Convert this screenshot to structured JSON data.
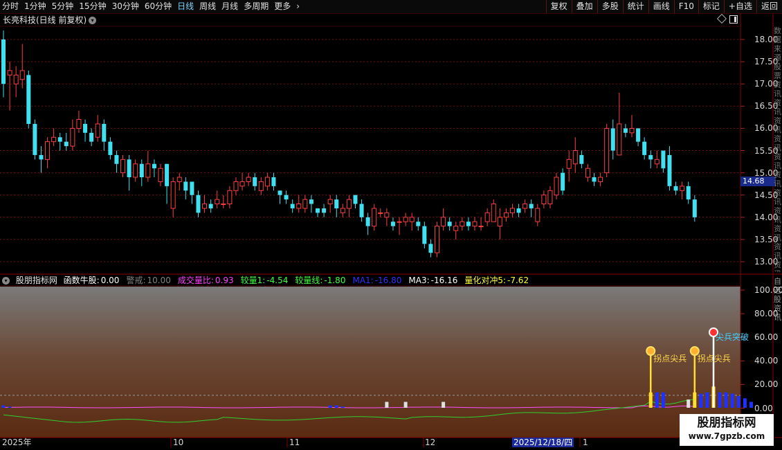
{
  "toolbar": {
    "periods": [
      "分时",
      "1分钟",
      "5分钟",
      "15分钟",
      "30分钟",
      "60分钟",
      "日线",
      "周线",
      "月线",
      "多周期",
      "更多"
    ],
    "active_period": "日线",
    "buttons": [
      "复权",
      "叠加",
      "多股",
      "统计",
      "画线",
      "F10",
      "标记",
      "+自选",
      "返回"
    ]
  },
  "chart_header": {
    "title": "长亮科技(日线 前复权)"
  },
  "price_axis": {
    "ticks": [
      "18.00",
      "17.50",
      "17.00",
      "16.50",
      "16.00",
      "15.50",
      "15.00",
      "14.50",
      "14.00",
      "13.50",
      "13.00"
    ]
  },
  "current_price": "14.68",
  "indicator": {
    "name": "股朋指标网",
    "items": [
      {
        "label": "函数牛股:",
        "value": "0.00",
        "color": "#ffffff"
      },
      {
        "label": "警戒:",
        "value": "10.00",
        "color": "#808080"
      },
      {
        "label": "成交量比:",
        "value": "0.93",
        "color": "#ff40ff"
      },
      {
        "label": "较量1:",
        "value": "-4.54",
        "color": "#40ff40"
      },
      {
        "label": "较量线:",
        "value": "-1.80",
        "color": "#40ff40"
      },
      {
        "label": "MA1:",
        "value": "-16.80",
        "color": "#3030ff"
      },
      {
        "label": "MA3:",
        "value": "-16.16",
        "color": "#ffffff"
      },
      {
        "label": "量化对冲5:",
        "value": "-7.62",
        "color": "#ffff40"
      }
    ],
    "axis_ticks": [
      "100.00",
      "80.00",
      "60.00",
      "40.00",
      "20.00",
      "0.00"
    ],
    "signals": [
      {
        "text": "拐点尖兵",
        "type": "buy-point"
      },
      {
        "text": "拐点尖兵",
        "type": "buy-point"
      },
      {
        "text": "尖兵突破",
        "type": "breakout"
      }
    ]
  },
  "edge_text": "数据来源股票资讯资讯资讯资讯资讯资讯资讯资讯资讯资讯资讯开盘资讯资讯",
  "edge_text_2": "自选股资讯",
  "date_axis": {
    "labels": [
      "2025年",
      "10",
      "11",
      "12",
      "1"
    ],
    "cursor_date": "2025/12/18/四"
  },
  "watermark": {
    "line1": "股朋指标网",
    "line2": "www.7gpzb.com"
  },
  "chart_data": {
    "type": "candlestick",
    "ylim": [
      12.8,
      18.4
    ],
    "candles": [
      [
        18.0,
        17.0,
        18.2,
        16.7
      ],
      [
        17.2,
        17.3,
        17.5,
        16.4
      ],
      [
        17.0,
        17.2,
        17.4,
        16.7
      ],
      [
        17.1,
        17.3,
        17.9,
        16.9
      ],
      [
        17.2,
        16.1,
        17.3,
        16.0
      ],
      [
        16.1,
        15.4,
        16.2,
        15.3
      ],
      [
        15.4,
        15.3,
        15.6,
        15.0
      ],
      [
        15.3,
        15.7,
        15.8,
        15.1
      ],
      [
        15.7,
        15.8,
        16.0,
        15.6
      ],
      [
        15.8,
        15.7,
        15.9,
        15.5
      ],
      [
        15.7,
        15.6,
        15.9,
        15.5
      ],
      [
        15.6,
        16.0,
        16.2,
        15.5
      ],
      [
        16.0,
        16.2,
        16.4,
        15.9
      ],
      [
        16.1,
        15.9,
        16.2,
        15.7
      ],
      [
        15.9,
        15.7,
        16.0,
        15.6
      ],
      [
        15.8,
        16.1,
        16.3,
        15.7
      ],
      [
        16.1,
        15.7,
        16.2,
        15.5
      ],
      [
        15.7,
        15.4,
        15.8,
        15.3
      ],
      [
        15.4,
        15.2,
        15.5,
        15.0
      ],
      [
        15.0,
        15.3,
        15.4,
        14.9
      ],
      [
        15.3,
        14.9,
        15.4,
        14.6
      ],
      [
        14.9,
        15.2,
        15.3,
        14.8
      ],
      [
        15.2,
        14.9,
        15.3,
        14.7
      ],
      [
        14.9,
        15.2,
        15.5,
        14.8
      ],
      [
        15.2,
        15.1,
        15.3,
        14.9
      ],
      [
        14.8,
        15.1,
        15.2,
        14.7
      ],
      [
        15.2,
        14.7,
        15.2,
        14.3
      ],
      [
        14.2,
        14.8,
        14.9,
        14.0
      ],
      [
        14.8,
        14.9,
        15.0,
        14.6
      ],
      [
        14.8,
        14.6,
        14.9,
        14.4
      ],
      [
        14.8,
        14.5,
        14.8,
        14.3
      ],
      [
        14.5,
        14.1,
        14.6,
        14.0
      ],
      [
        14.2,
        14.3,
        14.5,
        14.1
      ],
      [
        14.3,
        14.2,
        14.4,
        14.1
      ],
      [
        14.3,
        14.4,
        14.6,
        14.2
      ],
      [
        14.3,
        14.3,
        14.5,
        14.2
      ],
      [
        14.3,
        14.6,
        14.7,
        14.2
      ],
      [
        14.6,
        14.8,
        14.9,
        14.5
      ],
      [
        14.7,
        14.8,
        15.0,
        14.6
      ],
      [
        14.8,
        14.9,
        15.0,
        14.7
      ],
      [
        14.9,
        14.7,
        15.0,
        14.6
      ],
      [
        14.6,
        14.8,
        14.9,
        14.5
      ],
      [
        14.7,
        14.9,
        15.0,
        14.6
      ],
      [
        14.9,
        14.7,
        15.0,
        14.6
      ],
      [
        14.6,
        14.5,
        14.6,
        14.3
      ],
      [
        14.5,
        14.4,
        14.6,
        14.3
      ],
      [
        14.3,
        14.2,
        14.4,
        14.1
      ],
      [
        14.2,
        14.3,
        14.5,
        14.1
      ],
      [
        14.2,
        14.4,
        14.5,
        14.1
      ],
      [
        14.4,
        14.3,
        14.5,
        14.1
      ],
      [
        14.2,
        14.1,
        14.2,
        14.0
      ],
      [
        14.2,
        14.1,
        14.3,
        14.0
      ],
      [
        14.3,
        14.4,
        14.5,
        14.1
      ],
      [
        14.4,
        14.2,
        14.5,
        14.0
      ],
      [
        14.1,
        14.2,
        14.3,
        14.0
      ],
      [
        14.2,
        14.4,
        14.5,
        14.0
      ],
      [
        14.5,
        14.3,
        14.5,
        14.2
      ],
      [
        14.3,
        14.0,
        14.4,
        13.9
      ],
      [
        14.0,
        13.8,
        14.1,
        13.6
      ],
      [
        13.8,
        14.2,
        14.3,
        13.7
      ],
      [
        14.1,
        14.1,
        14.2,
        14.0
      ],
      [
        14.0,
        14.1,
        14.2,
        13.8
      ],
      [
        13.9,
        13.8,
        14.0,
        13.7
      ],
      [
        13.9,
        13.9,
        14.0,
        13.6
      ],
      [
        13.9,
        14.0,
        14.1,
        13.8
      ],
      [
        13.9,
        14.0,
        14.1,
        13.7
      ],
      [
        13.9,
        13.8,
        14.0,
        13.7
      ],
      [
        13.8,
        13.4,
        13.9,
        13.3
      ],
      [
        13.4,
        13.2,
        13.5,
        13.1
      ],
      [
        13.2,
        13.8,
        13.9,
        13.1
      ],
      [
        13.8,
        14.0,
        14.2,
        13.7
      ],
      [
        13.9,
        13.8,
        14.0,
        13.7
      ],
      [
        13.7,
        13.8,
        13.9,
        13.5
      ],
      [
        13.8,
        13.9,
        14.0,
        13.7
      ],
      [
        13.9,
        13.8,
        14.0,
        13.7
      ],
      [
        13.8,
        13.9,
        14.0,
        13.7
      ],
      [
        13.8,
        13.8,
        14.0,
        13.7
      ],
      [
        13.9,
        14.1,
        14.2,
        13.8
      ],
      [
        13.9,
        14.3,
        14.4,
        13.9
      ],
      [
        13.8,
        14.0,
        14.2,
        13.5
      ],
      [
        14.0,
        14.1,
        14.2,
        13.9
      ],
      [
        14.1,
        14.2,
        14.3,
        14.0
      ],
      [
        14.2,
        14.1,
        14.3,
        14.0
      ],
      [
        14.2,
        14.3,
        14.4,
        14.1
      ],
      [
        14.3,
        14.2,
        14.4,
        14.0
      ],
      [
        13.9,
        14.2,
        14.3,
        13.8
      ],
      [
        14.3,
        14.5,
        14.6,
        14.2
      ],
      [
        14.3,
        14.6,
        14.7,
        14.2
      ],
      [
        14.5,
        14.9,
        15.0,
        14.4
      ],
      [
        15.0,
        14.6,
        15.1,
        14.5
      ],
      [
        15.1,
        15.3,
        15.5,
        14.8
      ],
      [
        15.2,
        15.5,
        15.8,
        15.0
      ],
      [
        15.4,
        15.2,
        15.5,
        15.1
      ],
      [
        14.9,
        15.1,
        15.2,
        14.8
      ],
      [
        14.9,
        14.8,
        15.0,
        14.7
      ],
      [
        14.8,
        14.9,
        15.0,
        14.7
      ],
      [
        15.0,
        16.0,
        16.1,
        14.9
      ],
      [
        16.0,
        15.5,
        16.2,
        15.3
      ],
      [
        15.4,
        16.1,
        16.8,
        15.4
      ],
      [
        16.0,
        15.9,
        16.1,
        15.8
      ],
      [
        15.9,
        16.0,
        16.3,
        15.8
      ],
      [
        16.0,
        15.7,
        16.0,
        15.6
      ],
      [
        15.7,
        15.4,
        15.8,
        15.3
      ],
      [
        15.4,
        15.3,
        15.5,
        15.1
      ],
      [
        15.2,
        15.3,
        15.5,
        15.1
      ],
      [
        15.5,
        15.1,
        15.5,
        15.0
      ],
      [
        15.4,
        14.7,
        15.6,
        14.6
      ],
      [
        14.7,
        14.6,
        14.8,
        14.5
      ],
      [
        14.6,
        14.7,
        14.8,
        14.4
      ],
      [
        14.7,
        14.4,
        14.8,
        14.3
      ],
      [
        14.4,
        14.0,
        14.5,
        13.9
      ]
    ],
    "volume_bars": [
      {
        "i": 0,
        "v": 2,
        "color": "blue"
      },
      {
        "i": 1,
        "v": 1,
        "color": "blue"
      },
      {
        "i": 52,
        "v": 2,
        "color": "blue"
      },
      {
        "i": 53,
        "v": 2,
        "color": "blue"
      },
      {
        "i": 54,
        "v": 1,
        "color": "blue"
      },
      {
        "i": 61,
        "v": 5,
        "color": "white"
      },
      {
        "i": 64,
        "v": 5,
        "color": "white"
      },
      {
        "i": 70,
        "v": 5,
        "color": "white"
      },
      {
        "i": 103,
        "v": 13,
        "color": "yellow"
      },
      {
        "i": 104,
        "v": 13,
        "color": "blue"
      },
      {
        "i": 105,
        "v": 13,
        "color": "blue"
      },
      {
        "i": 109,
        "v": 7,
        "color": "white"
      },
      {
        "i": 110,
        "v": 13,
        "color": "yellow"
      },
      {
        "i": 111,
        "v": 12,
        "color": "blue"
      },
      {
        "i": 112,
        "v": 13,
        "color": "blue"
      },
      {
        "i": 113,
        "v": 18,
        "color": "yellow"
      },
      {
        "i": 114,
        "v": 13,
        "color": "blue"
      },
      {
        "i": 115,
        "v": 13,
        "color": "blue"
      },
      {
        "i": 116,
        "v": 12,
        "color": "blue"
      },
      {
        "i": 117,
        "v": 10,
        "color": "blue"
      },
      {
        "i": 118,
        "v": 8,
        "color": "blue"
      },
      {
        "i": 119,
        "v": 5,
        "color": "blue"
      }
    ]
  }
}
